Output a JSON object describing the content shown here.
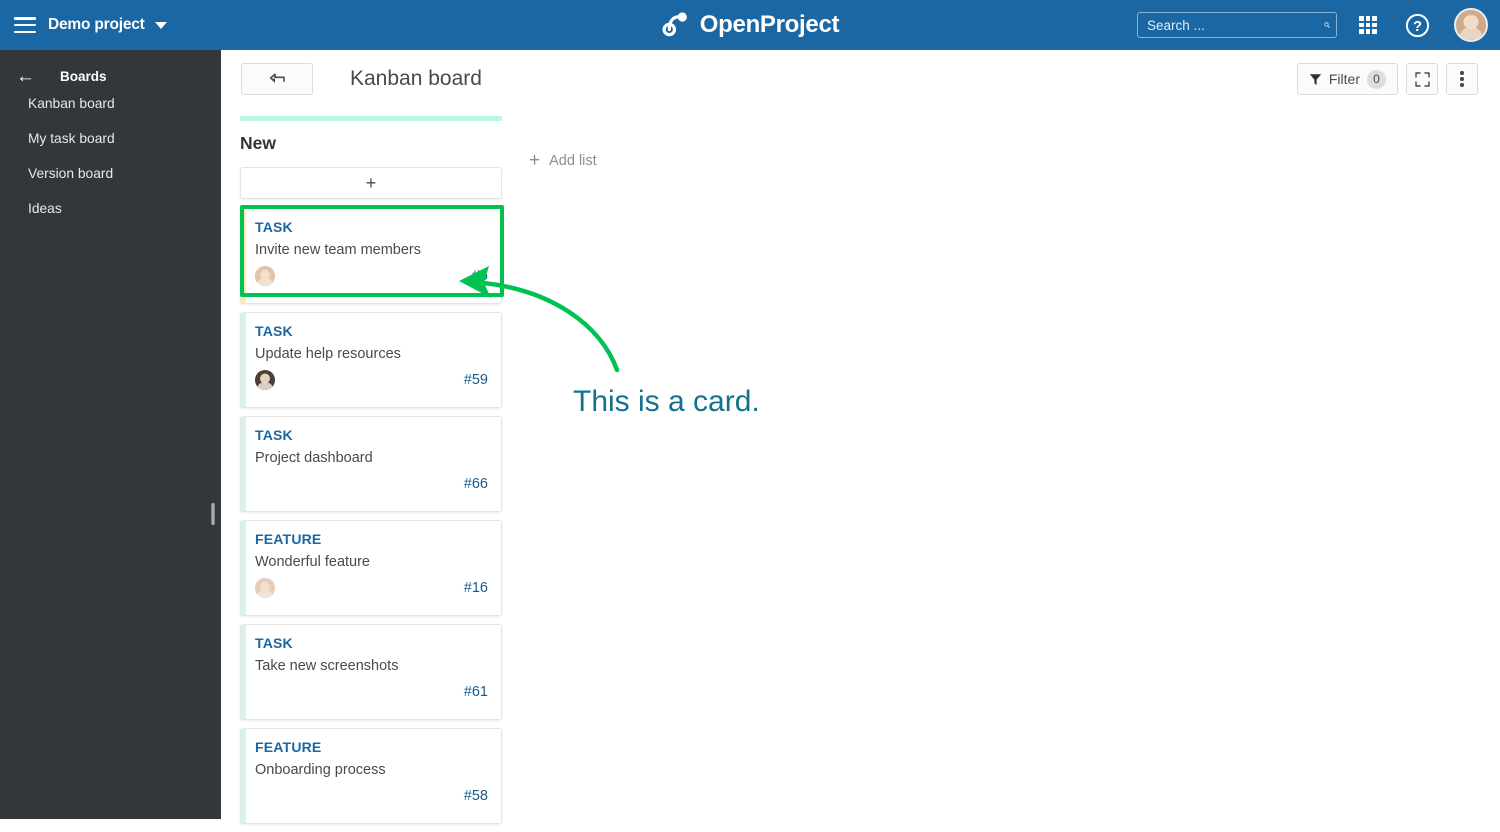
{
  "header": {
    "menu_icon": "hamburger-icon",
    "project_name": "Demo project",
    "dropdown_icon": "caret-down-icon",
    "logo_text": "OpenProject",
    "logo_icon": "openproject-logo-icon",
    "search": {
      "placeholder": "Search ...",
      "value": "",
      "icon": "search-icon"
    },
    "modules_icon": "grid-modules-icon",
    "help_icon": "help-circle-icon",
    "avatar": "user-avatar",
    "background_color": "#1A67A3"
  },
  "sidebar": {
    "back_icon": "arrow-left-icon",
    "title": "Boards",
    "background_color": "#32373B",
    "items": [
      {
        "label": "Kanban board"
      },
      {
        "label": "My task board"
      },
      {
        "label": "Version board"
      },
      {
        "label": "Ideas"
      }
    ],
    "resize_handle": "sidebar-resize-handle"
  },
  "toolbar": {
    "back_button_icon": "back-return-arrow-icon",
    "page_title": "Kanban board",
    "filter_label": "Filter",
    "filter_count": "0",
    "filter_icon": "funnel-icon",
    "fullscreen_icon": "fullscreen-expand-icon",
    "more_icon": "more-vertical-icon"
  },
  "board": {
    "add_list_label": "Add list",
    "add_list_icon": "plus-icon",
    "columns": [
      {
        "title": "New",
        "top_bar_color": "#B9F7DF",
        "add_card_icon": "plus-icon",
        "cards": [
          {
            "type": "TASK",
            "title": "Invite new team members",
            "id": "#6",
            "stripe": "yellow",
            "avatar": true,
            "avatar_color": "#e4c3ad",
            "highlighted": true
          },
          {
            "type": "TASK",
            "title": "Update help resources",
            "id": "#59",
            "stripe": "green",
            "avatar": true,
            "avatar_color": "#4a4035",
            "highlighted": false
          },
          {
            "type": "TASK",
            "title": "Project dashboard",
            "id": "#66",
            "stripe": "green",
            "avatar": false,
            "avatar_color": "",
            "highlighted": false
          },
          {
            "type": "FEATURE",
            "title": "Wonderful feature",
            "id": "#16",
            "stripe": "green",
            "avatar": true,
            "avatar_color": "#e8cdbb",
            "highlighted": false
          },
          {
            "type": "TASK",
            "title": "Take new screenshots",
            "id": "#61",
            "stripe": "green",
            "avatar": false,
            "avatar_color": "",
            "highlighted": false
          },
          {
            "type": "FEATURE",
            "title": "Onboarding process",
            "id": "#58",
            "stripe": "green",
            "avatar": false,
            "avatar_color": "",
            "highlighted": false
          }
        ]
      }
    ]
  },
  "annotation": {
    "text": "This is a card.",
    "text_color": "#12728E",
    "highlight_color": "#00C250",
    "arrow_icon": "curved-arrow-icon"
  }
}
